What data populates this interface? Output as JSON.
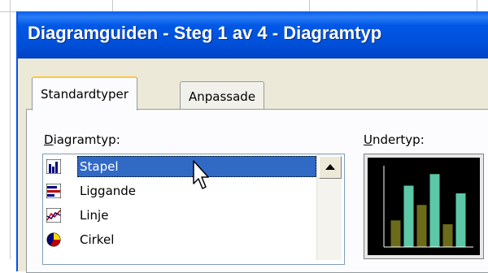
{
  "dialog": {
    "title": "Diagramguiden - Steg 1 av 4 - Diagramtyp",
    "tabs": [
      {
        "label": "Standardtyper",
        "active": true
      },
      {
        "label": "Anpassade",
        "active": false
      }
    ],
    "chart_type_label": "Diagramtyp:",
    "chart_type_accesskey": "D",
    "subtype_label": "Undertyp:",
    "subtype_accesskey": "U",
    "chart_types": [
      {
        "label": "Stapel",
        "icon": "column-chart-icon",
        "selected": true
      },
      {
        "label": "Liggande",
        "icon": "bar-chart-icon",
        "selected": false
      },
      {
        "label": "Linje",
        "icon": "line-chart-icon",
        "selected": false
      },
      {
        "label": "Cirkel",
        "icon": "pie-chart-icon",
        "selected": false
      }
    ],
    "subtype_preview": {
      "bars": [
        0.35,
        0.8,
        0.55,
        0.95,
        0.3,
        0.7
      ],
      "colors": [
        "#6b6b1a",
        "#5cc8a8"
      ]
    }
  },
  "colors": {
    "titlebar": "#0055e5",
    "selection": "#316ac5",
    "dialog_bg": "#ece9d8",
    "active_tab_accent": "#ffc83d"
  }
}
